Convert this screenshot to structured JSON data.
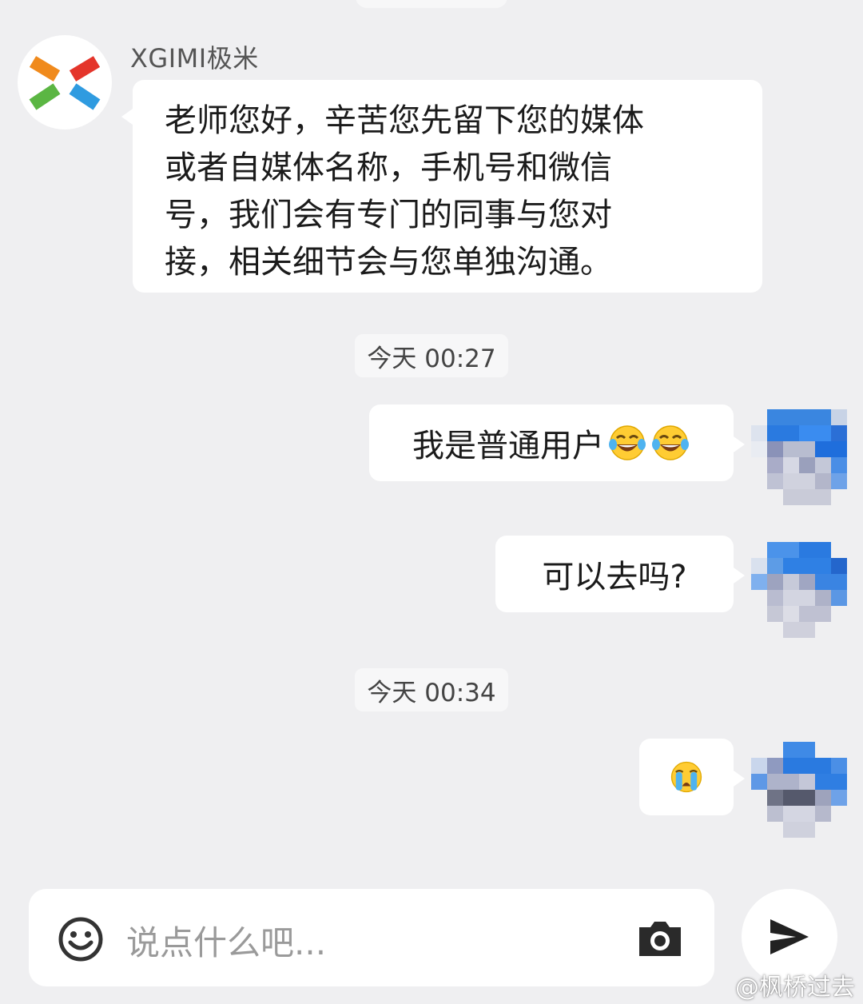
{
  "chat": {
    "incoming": {
      "sender": "XGIMI极米",
      "lines": [
        "老师您好，辛苦您先留下您的媒体",
        "或者自媒体名称，手机号和微信",
        "号，我们会有专门的同事与您对",
        "接，相关细节会与您单独沟通。"
      ]
    },
    "timestamps": [
      "今天 00:27",
      "今天 00:34"
    ],
    "outgoing": [
      {
        "text": "我是普通用户",
        "emojis": [
          "tears-of-joy",
          "tears-of-joy"
        ]
      },
      {
        "text": "可以去吗?"
      },
      {
        "text": "",
        "emojis": [
          "loudly-crying"
        ]
      }
    ]
  },
  "input": {
    "placeholder": "说点什么吧..."
  },
  "watermark": "@枫桥过去",
  "icons": {
    "avatar": "xgimi-logo-icon",
    "emoji_toggle": "smiley-icon",
    "camera": "camera-icon",
    "send": "send-arrow-icon"
  },
  "colors": {
    "background": "#efeff1",
    "bubble": "#ffffff",
    "logo_orange": "#f08a1c",
    "logo_red": "#e4352b",
    "logo_green": "#5bb643",
    "logo_blue": "#2f9be0"
  }
}
